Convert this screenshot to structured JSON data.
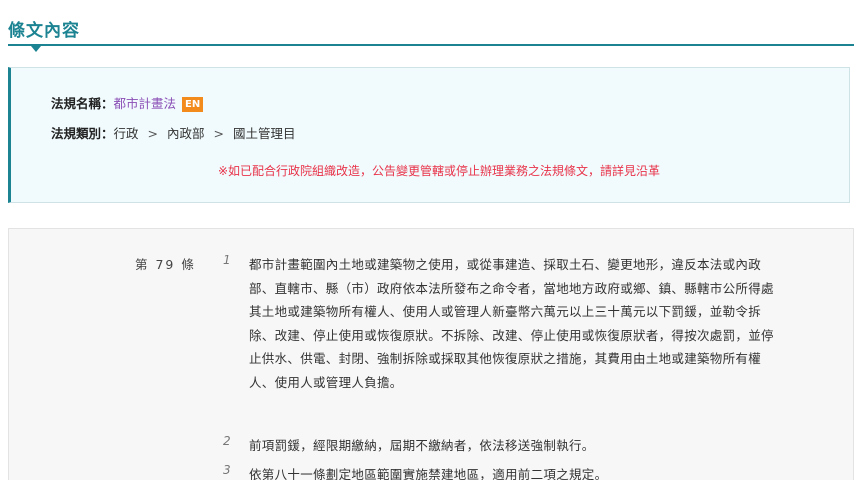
{
  "section": {
    "title": "條文內容"
  },
  "info": {
    "name_label": "法規名稱：",
    "law_name": "都市計畫法",
    "en_badge": "EN",
    "category_label": "法規類別：",
    "categories": [
      "行政",
      "內政部",
      "國土管理目"
    ],
    "category_separator": ">",
    "notice": "※如已配合行政院組織改造，公告變更管轄或停止辦理業務之法規條文，請詳見沿革"
  },
  "article": {
    "number": "第 79 條",
    "paragraphs": [
      {
        "num": "1",
        "text": "都市計畫範圍內土地或建築物之使用，或從事建造、採取土石、變更地形，違反本法或內政部、直轄市、縣（市）政府依本法所發布之命令者，當地地方政府或鄉、鎮、縣轄市公所得處其土地或建築物所有權人、使用人或管理人新臺幣六萬元以上三十萬元以下罰鍰，並勒令拆除、改建、停止使用或恢復原狀。不拆除、改建、停止使用或恢復原狀者，得按次處罰，並停止供水、供電、封閉、強制拆除或採取其他恢復原狀之措施，其費用由土地或建築物所有權人、使用人或管理人負擔。"
      },
      {
        "num": "2",
        "text": "前項罰鍰，經限期繳納，屆期不繳納者，依法移送強制執行。"
      },
      {
        "num": "3",
        "text": "依第八十一條劃定地區範圍實施禁建地區，適用前二項之規定。"
      }
    ]
  }
}
